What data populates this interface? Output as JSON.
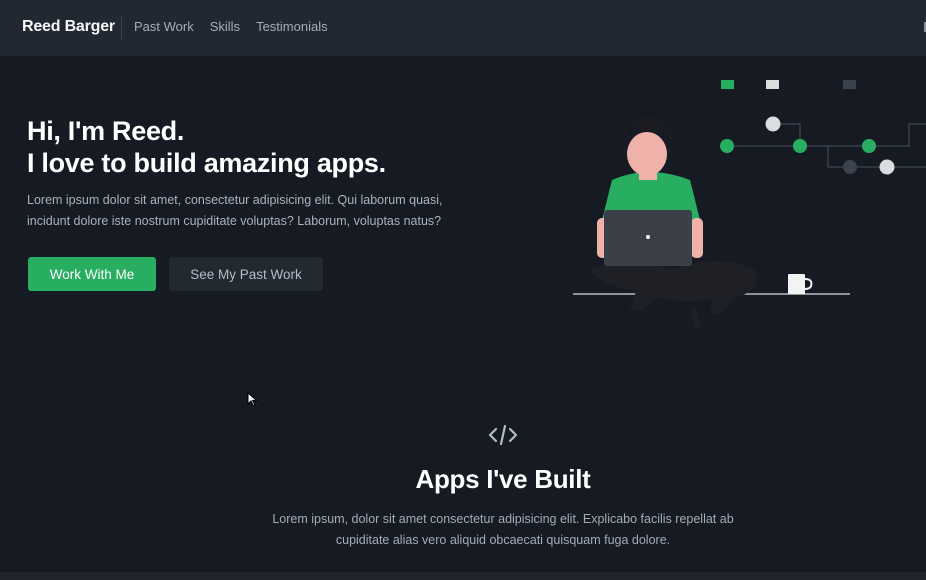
{
  "header": {
    "brand": "Reed Barger",
    "nav": [
      "Past Work",
      "Skills",
      "Testimonials"
    ]
  },
  "hero": {
    "title_line1": "Hi, I'm Reed.",
    "title_line2": "I love to build amazing apps.",
    "description": "Lorem ipsum dolor sit amet, consectetur adipisicing elit. Qui laborum quasi, incidunt dolore iste nostrum cupiditate voluptas? Laborum, voluptas natus?",
    "primary_button": "Work With Me",
    "secondary_button": "See My Past Work"
  },
  "section": {
    "title": "Apps I've Built",
    "description": "Lorem ipsum, dolor sit amet consectetur adipisicing elit. Explicabo facilis repellat ab cupiditate alias vero aliquid obcaecati quisquam fuga dolore."
  },
  "colors": {
    "background": "#161a22",
    "header": "#222831",
    "accent": "#27ae60",
    "secondary_button": "#232931"
  },
  "icons": [
    "code-icon",
    "mouse-cursor-icon",
    "developer-illustration"
  ]
}
